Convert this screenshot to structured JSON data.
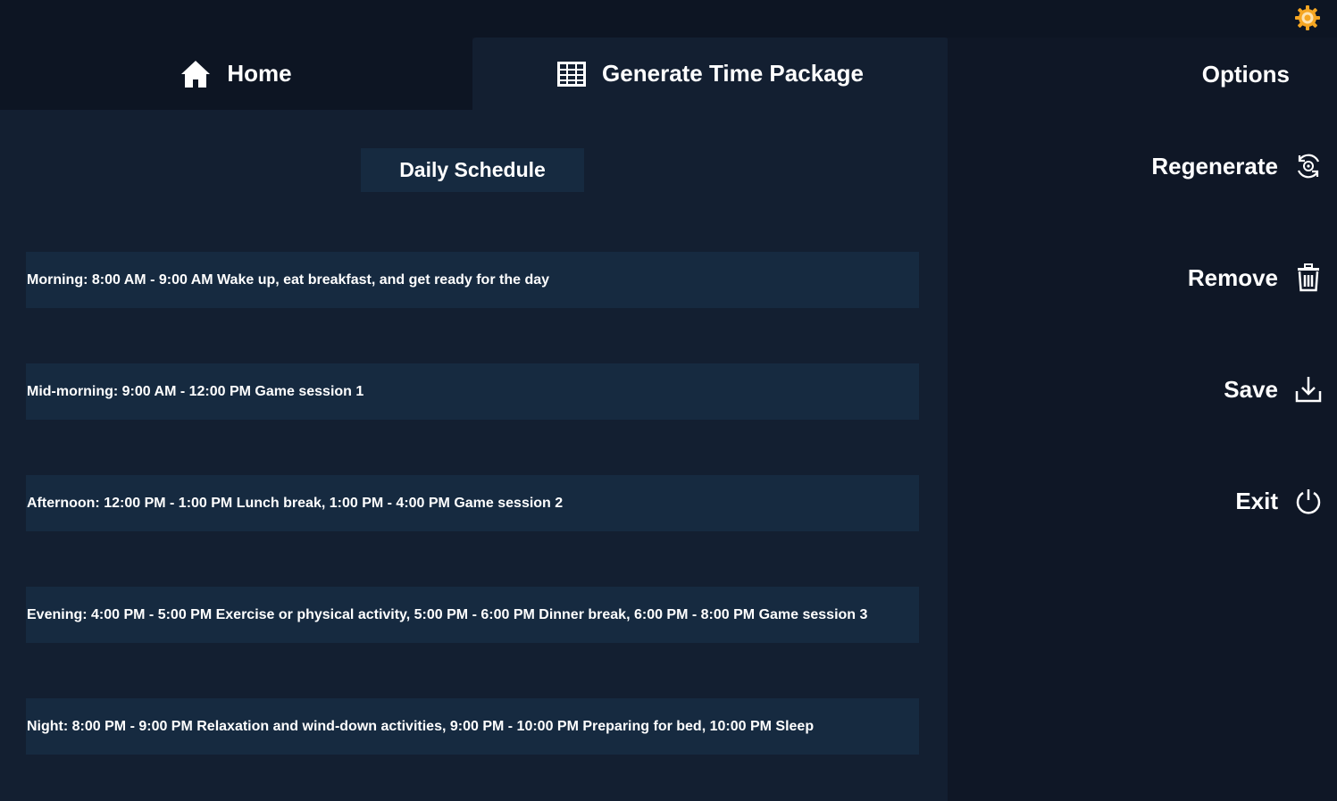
{
  "tabs": {
    "home_label": "Home",
    "generate_label": "Generate Time Package"
  },
  "schedule": {
    "title": "Daily Schedule",
    "rows": [
      "Morning: 8:00 AM - 9:00 AM Wake up, eat breakfast, and get ready for the day",
      "Mid-morning: 9:00 AM - 12:00 PM Game session 1",
      "Afternoon: 12:00 PM - 1:00 PM Lunch break, 1:00 PM - 4:00 PM Game session 2",
      "Evening: 4:00 PM - 5:00 PM Exercise or physical activity, 5:00 PM - 6:00 PM Dinner break, 6:00 PM - 8:00 PM Game session 3",
      "Night: 8:00 PM - 9:00 PM Relaxation and wind-down activities, 9:00 PM - 10:00 PM Preparing for bed, 10:00 PM Sleep"
    ]
  },
  "options": {
    "title": "Options",
    "regenerate_label": "Regenerate",
    "remove_label": "Remove",
    "save_label": "Save",
    "exit_label": "Exit"
  },
  "icons": {
    "settings": "gear-icon",
    "home": "home-icon",
    "generate": "table-grid-icon",
    "regenerate": "refresh-icon",
    "remove": "trash-icon",
    "save": "download-icon",
    "exit": "power-icon"
  },
  "colors": {
    "background": "#0f1726",
    "panel": "#131f31",
    "row": "#162a40",
    "accent_gear": "#f5a623",
    "text": "#ffffff"
  }
}
